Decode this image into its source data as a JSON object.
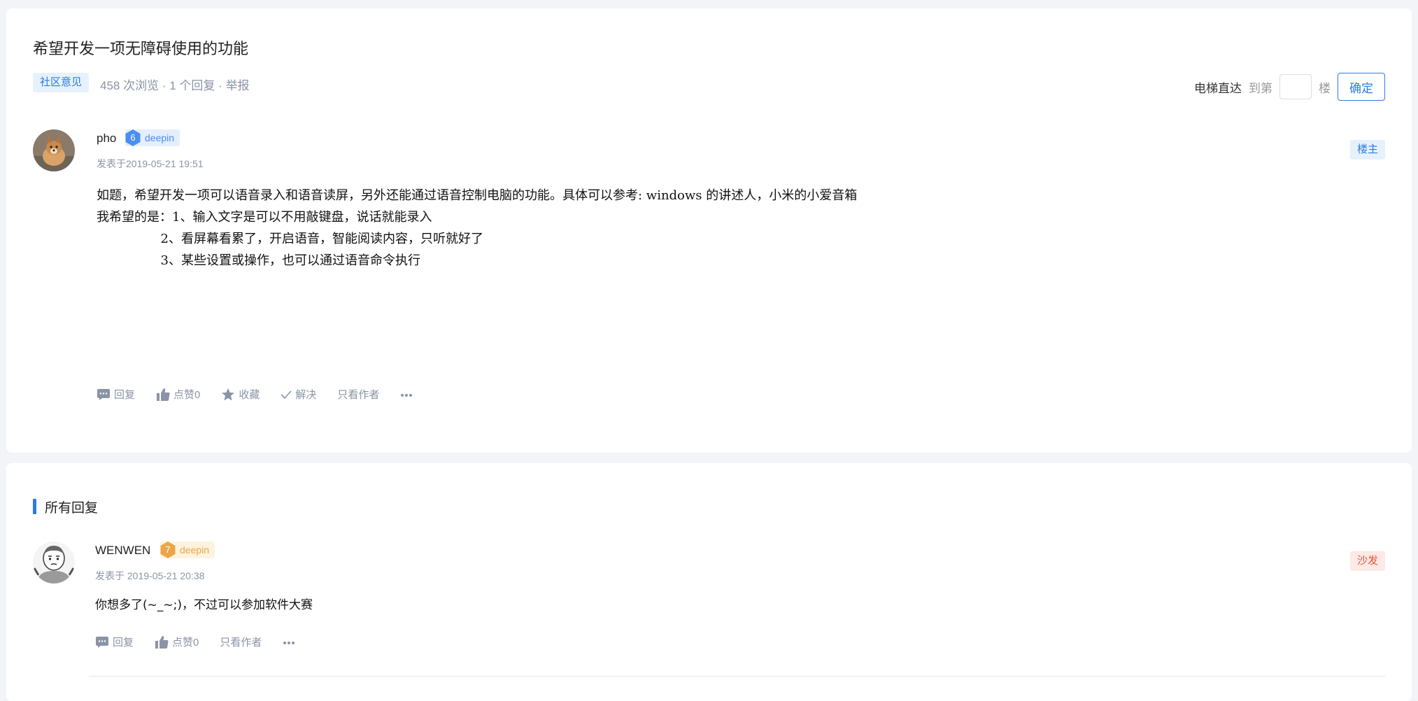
{
  "topic": {
    "title": "希望开发一项无障碍使用的功能",
    "category": "社区意见",
    "views_text": "458 次浏览",
    "separator": "·",
    "replies_text": "1 个回复",
    "report_label": "举报"
  },
  "elevator": {
    "label": "电梯直达",
    "to_label": "到第",
    "floor_label": "楼",
    "input_value": "",
    "confirm_label": "确定"
  },
  "original_post": {
    "username": "pho",
    "level": "6",
    "level_name": "deepin",
    "level_color": "#4a8ff0",
    "time": "发表于2019-05-21 19:51",
    "role": "楼主",
    "body": {
      "line1": "如题，希望开发一项可以语音录入和语音读屏，另外还能通过语音控制电脑的功能。具体可以参考: windows 的讲述人，小米的小爱音箱",
      "line2": "我希望的是：1、输入文字是可以不用敲键盘，说话就能录入",
      "line3": "                2、看屏幕看累了，开启语音，智能阅读内容，只听就好了",
      "line4": "                3、某些设置或操作，也可以通过语音命令执行"
    },
    "actions": {
      "reply": "回复",
      "like": "点赞0",
      "favorite": "收藏",
      "solve": "解决",
      "author_only": "只看作者",
      "more_icon": "more-dots-icon"
    }
  },
  "replies_section": {
    "title": "所有回复"
  },
  "replies": [
    {
      "username": "WENWEN",
      "level": "7",
      "level_name": "deepin",
      "level_color": "#eaa64a",
      "time": "发表于 2019-05-21 20:38",
      "role": "沙发",
      "body": "你想多了(~_~;)，不过可以参加软件大赛",
      "actions": {
        "reply": "回复",
        "like": "点赞0",
        "author_only": "只看作者"
      }
    }
  ],
  "colors": {
    "accent": "#2c7be5",
    "muted": "#8a94a6",
    "page_bg": "#f2f4f7",
    "sofa": "#e5553a"
  }
}
